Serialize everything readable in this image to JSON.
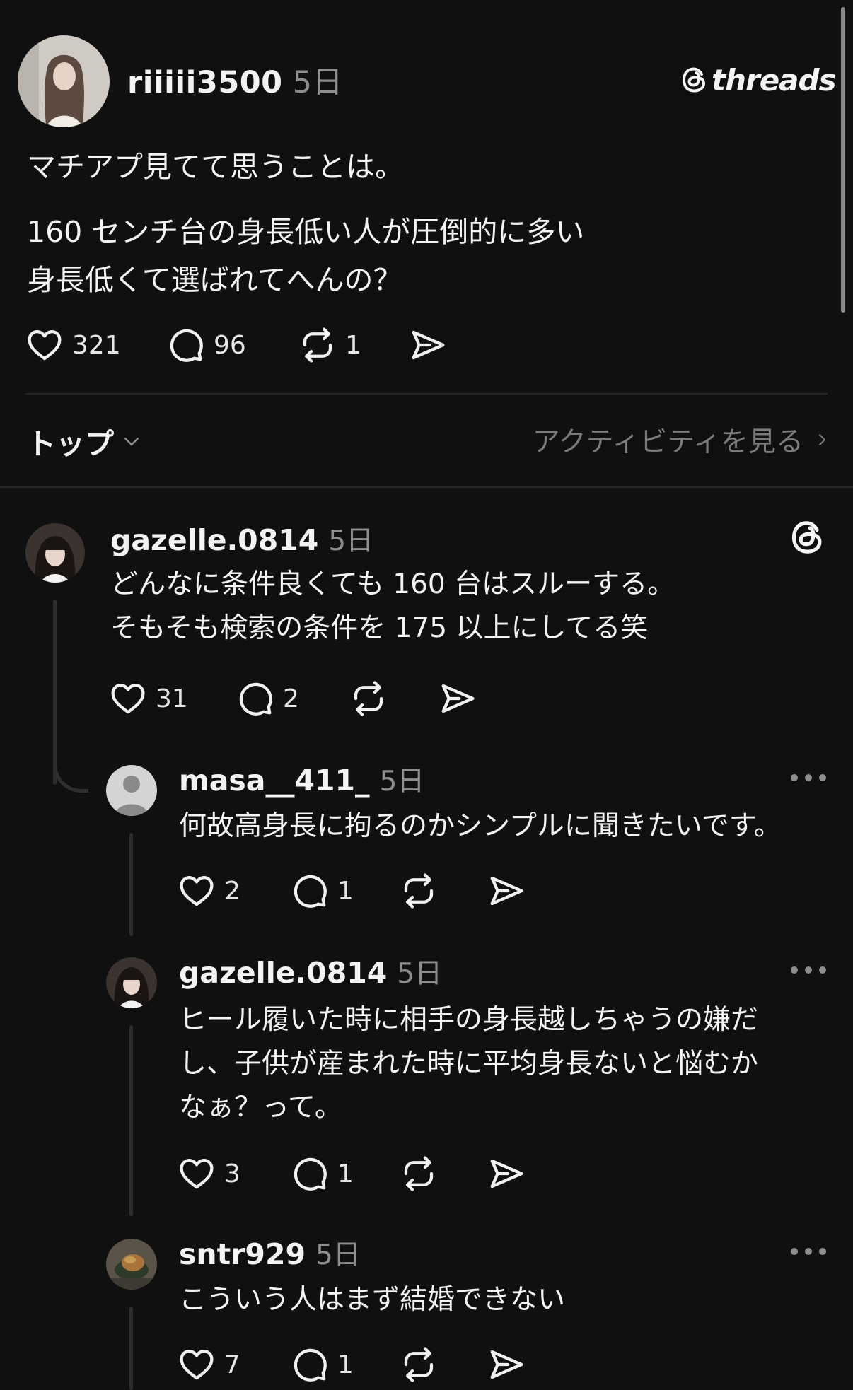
{
  "post": {
    "username": "riiiii3500",
    "time": "5日",
    "brand": "threads",
    "text_line1": "マチアプ見てて思うことは。",
    "text_line2": "160 センチ台の身長低い人が圧倒的に多い",
    "text_line3": "身長低くて選ばれてへんの？",
    "likes": "321",
    "comments": "96",
    "reposts": "1"
  },
  "sort": {
    "label": "トップ",
    "activity_link": "アクティビティを見る"
  },
  "replies": [
    {
      "username": "gazelle.0814",
      "time": "5日",
      "lines": [
        "どんなに条件良くても 160 台はスルーする。",
        "そもそも検索の条件を 175 以上にしてる笑"
      ],
      "likes": "31",
      "comments": "2",
      "reposts": ""
    },
    {
      "username": "masa__411_",
      "time": "5日",
      "lines": [
        "何故高身長に拘るのかシンプルに聞きたいです。"
      ],
      "likes": "2",
      "comments": "1",
      "reposts": ""
    },
    {
      "username": "gazelle.0814",
      "time": "5日",
      "lines": [
        "ヒール履いた時に相手の身長越しちゃうの嫌だ",
        "し、子供が産まれた時に平均身長ないと悩むか",
        "なぁ？って。"
      ],
      "likes": "3",
      "comments": "1",
      "reposts": ""
    },
    {
      "username": "sntr929",
      "time": "5日",
      "lines": [
        "こういう人はまず結婚できない"
      ],
      "likes": "7",
      "comments": "1",
      "reposts": ""
    }
  ],
  "icons": [
    "heart-icon",
    "comment-icon",
    "repost-icon",
    "share-icon",
    "threads-logo-icon",
    "more-icon",
    "chevron-down-icon",
    "chevron-right-icon"
  ],
  "colors": {
    "background": "#101010",
    "text": "#f3f3f3",
    "muted": "#8e8e8e",
    "divider": "#262626"
  }
}
